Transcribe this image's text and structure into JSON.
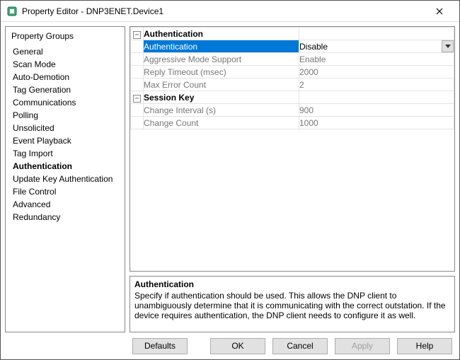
{
  "window": {
    "title": "Property Editor - DNP3ENET.Device1"
  },
  "sidebar": {
    "heading": "Property Groups",
    "items": [
      "General",
      "Scan Mode",
      "Auto-Demotion",
      "Tag Generation",
      "Communications",
      "Polling",
      "Unsolicited",
      "Event Playback",
      "Tag Import",
      "Authentication",
      "Update Key Authentication",
      "File Control",
      "Advanced",
      "Redundancy"
    ],
    "selected_index": 9
  },
  "groups": [
    {
      "name": "Authentication",
      "rows": [
        {
          "label": "Authentication",
          "value": "Disable",
          "selected": true,
          "dropdown": true
        },
        {
          "label": "Aggressive Mode Support",
          "value": "Enable"
        },
        {
          "label": "Reply Timeout (msec)",
          "value": "2000"
        },
        {
          "label": "Max Error Count",
          "value": "2"
        }
      ]
    },
    {
      "name": "Session Key",
      "rows": [
        {
          "label": "Change Interval (s)",
          "value": "900"
        },
        {
          "label": "Change Count",
          "value": "1000"
        }
      ]
    }
  ],
  "description": {
    "title": "Authentication",
    "body": "Specify if authentication should be used. This allows the DNP client to unambiguously determine that it is communicating with the correct outstation. If the device requires authentication, the DNP client needs to configure it as well."
  },
  "buttons": {
    "defaults": "Defaults",
    "ok": "OK",
    "cancel": "Cancel",
    "apply": "Apply",
    "help": "Help"
  }
}
